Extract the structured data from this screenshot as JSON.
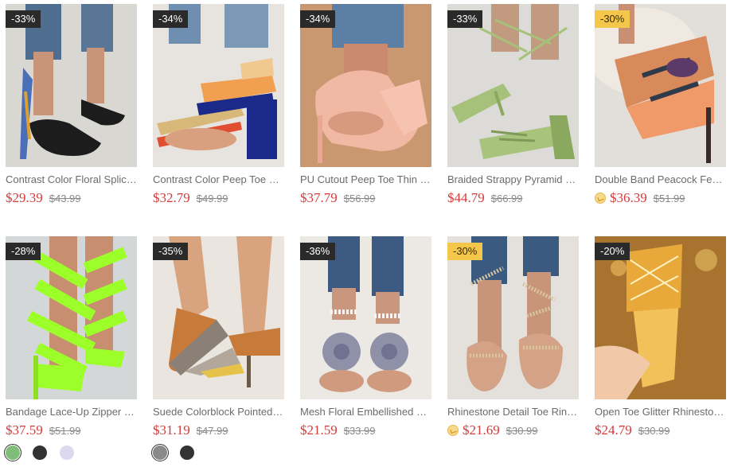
{
  "products": [
    {
      "badge": "-33%",
      "badge_style": "dark",
      "title": "Contrast Color Floral Splicing Ankle Strap Heeled Sandals",
      "price": "$29.39",
      "original_price": "$43.99",
      "vip": false,
      "bg": "#d9d7d2"
    },
    {
      "badge": "-34%",
      "badge_style": "dark",
      "title": "Contrast Color Peep Toe Chunky Heeled Sandals",
      "price": "$32.79",
      "original_price": "$49.99",
      "vip": false,
      "bg": "#e7e4e0"
    },
    {
      "badge": "-34%",
      "badge_style": "dark",
      "title": "PU Cutout Peep Toe Thin Heeled Pumps",
      "price": "$37.79",
      "original_price": "$56.99",
      "vip": false,
      "bg": "#c99770"
    },
    {
      "badge": "-33%",
      "badge_style": "dark",
      "title": "Braided Strappy Pyramid Heeled Sandals",
      "price": "$44.79",
      "original_price": "$66.99",
      "vip": false,
      "bg": "#dcdbd8"
    },
    {
      "badge": "-30%",
      "badge_style": "gold",
      "title": "Double Band Peacock Feather Print Heeled Sandals",
      "price": "$36.39",
      "original_price": "$51.99",
      "vip": true,
      "bg": "#e9e6e2"
    },
    {
      "badge": "-28%",
      "badge_style": "dark",
      "title": "Bandage Lace-Up Zipper Back Heeled Sandals",
      "price": "$37.59",
      "original_price": "$51.99",
      "vip": false,
      "bg": "#d7dadb",
      "swatches": [
        {
          "color": "#7fbe7a",
          "selected": true
        },
        {
          "color": "#333333",
          "selected": false
        },
        {
          "color": "#dcd9ee",
          "selected": false
        }
      ]
    },
    {
      "badge": "-35%",
      "badge_style": "dark",
      "title": "Suede Colorblock Pointed Toe Kitten Heels",
      "price": "$31.19",
      "original_price": "$47.99",
      "vip": false,
      "bg": "#ebe6df",
      "swatches": [
        {
          "color": "#8a8a8a",
          "selected": true
        },
        {
          "color": "#333333",
          "selected": false
        }
      ]
    },
    {
      "badge": "-36%",
      "badge_style": "dark",
      "title": "Mesh Floral Embellished Beaded Flat Sandals",
      "price": "$21.59",
      "original_price": "$33.99",
      "vip": false,
      "bg": "#efedea"
    },
    {
      "badge": "-30%",
      "badge_style": "gold",
      "title": "Rhinestone Detail Toe Ring Flat Sandals",
      "price": "$21.69",
      "original_price": "$30.99",
      "vip": true,
      "bg": "#e6e3df"
    },
    {
      "badge": "-20%",
      "badge_style": "dark",
      "title": "Open Toe Glitter Rhinestone Slippers",
      "price": "$24.79",
      "original_price": "$30.99",
      "vip": false,
      "bg": "#b8873a"
    }
  ]
}
